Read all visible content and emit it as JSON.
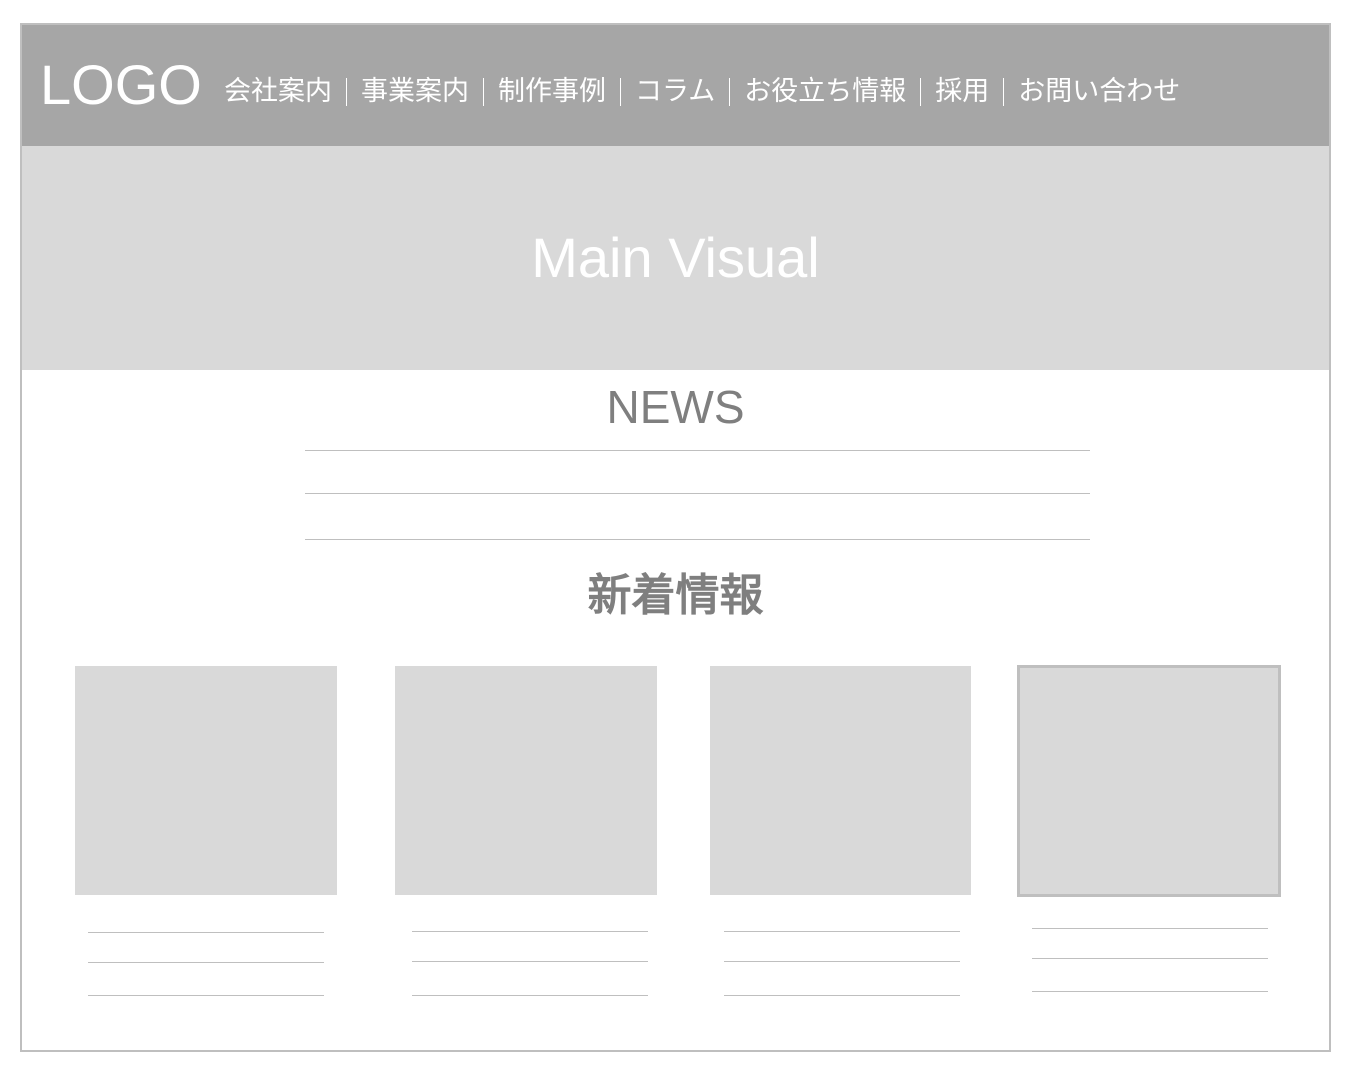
{
  "header": {
    "logo": "LOGO",
    "nav": [
      "会社案内",
      "事業案内",
      "制作事例",
      "コラム",
      "お役立ち情報",
      "採用",
      "お問い合わせ"
    ]
  },
  "hero": {
    "title": "Main Visual"
  },
  "news": {
    "title": "NEWS",
    "line_count": 3
  },
  "latest": {
    "title": "新着情報",
    "card_count": 4,
    "card_text_lines": 3
  },
  "colors": {
    "header_bg": "#a6a6a6",
    "placeholder_gray": "#d9d9d9",
    "line_gray": "#bfbfbf",
    "heading_gray": "#7f7f7f",
    "text_white": "#ffffff"
  }
}
